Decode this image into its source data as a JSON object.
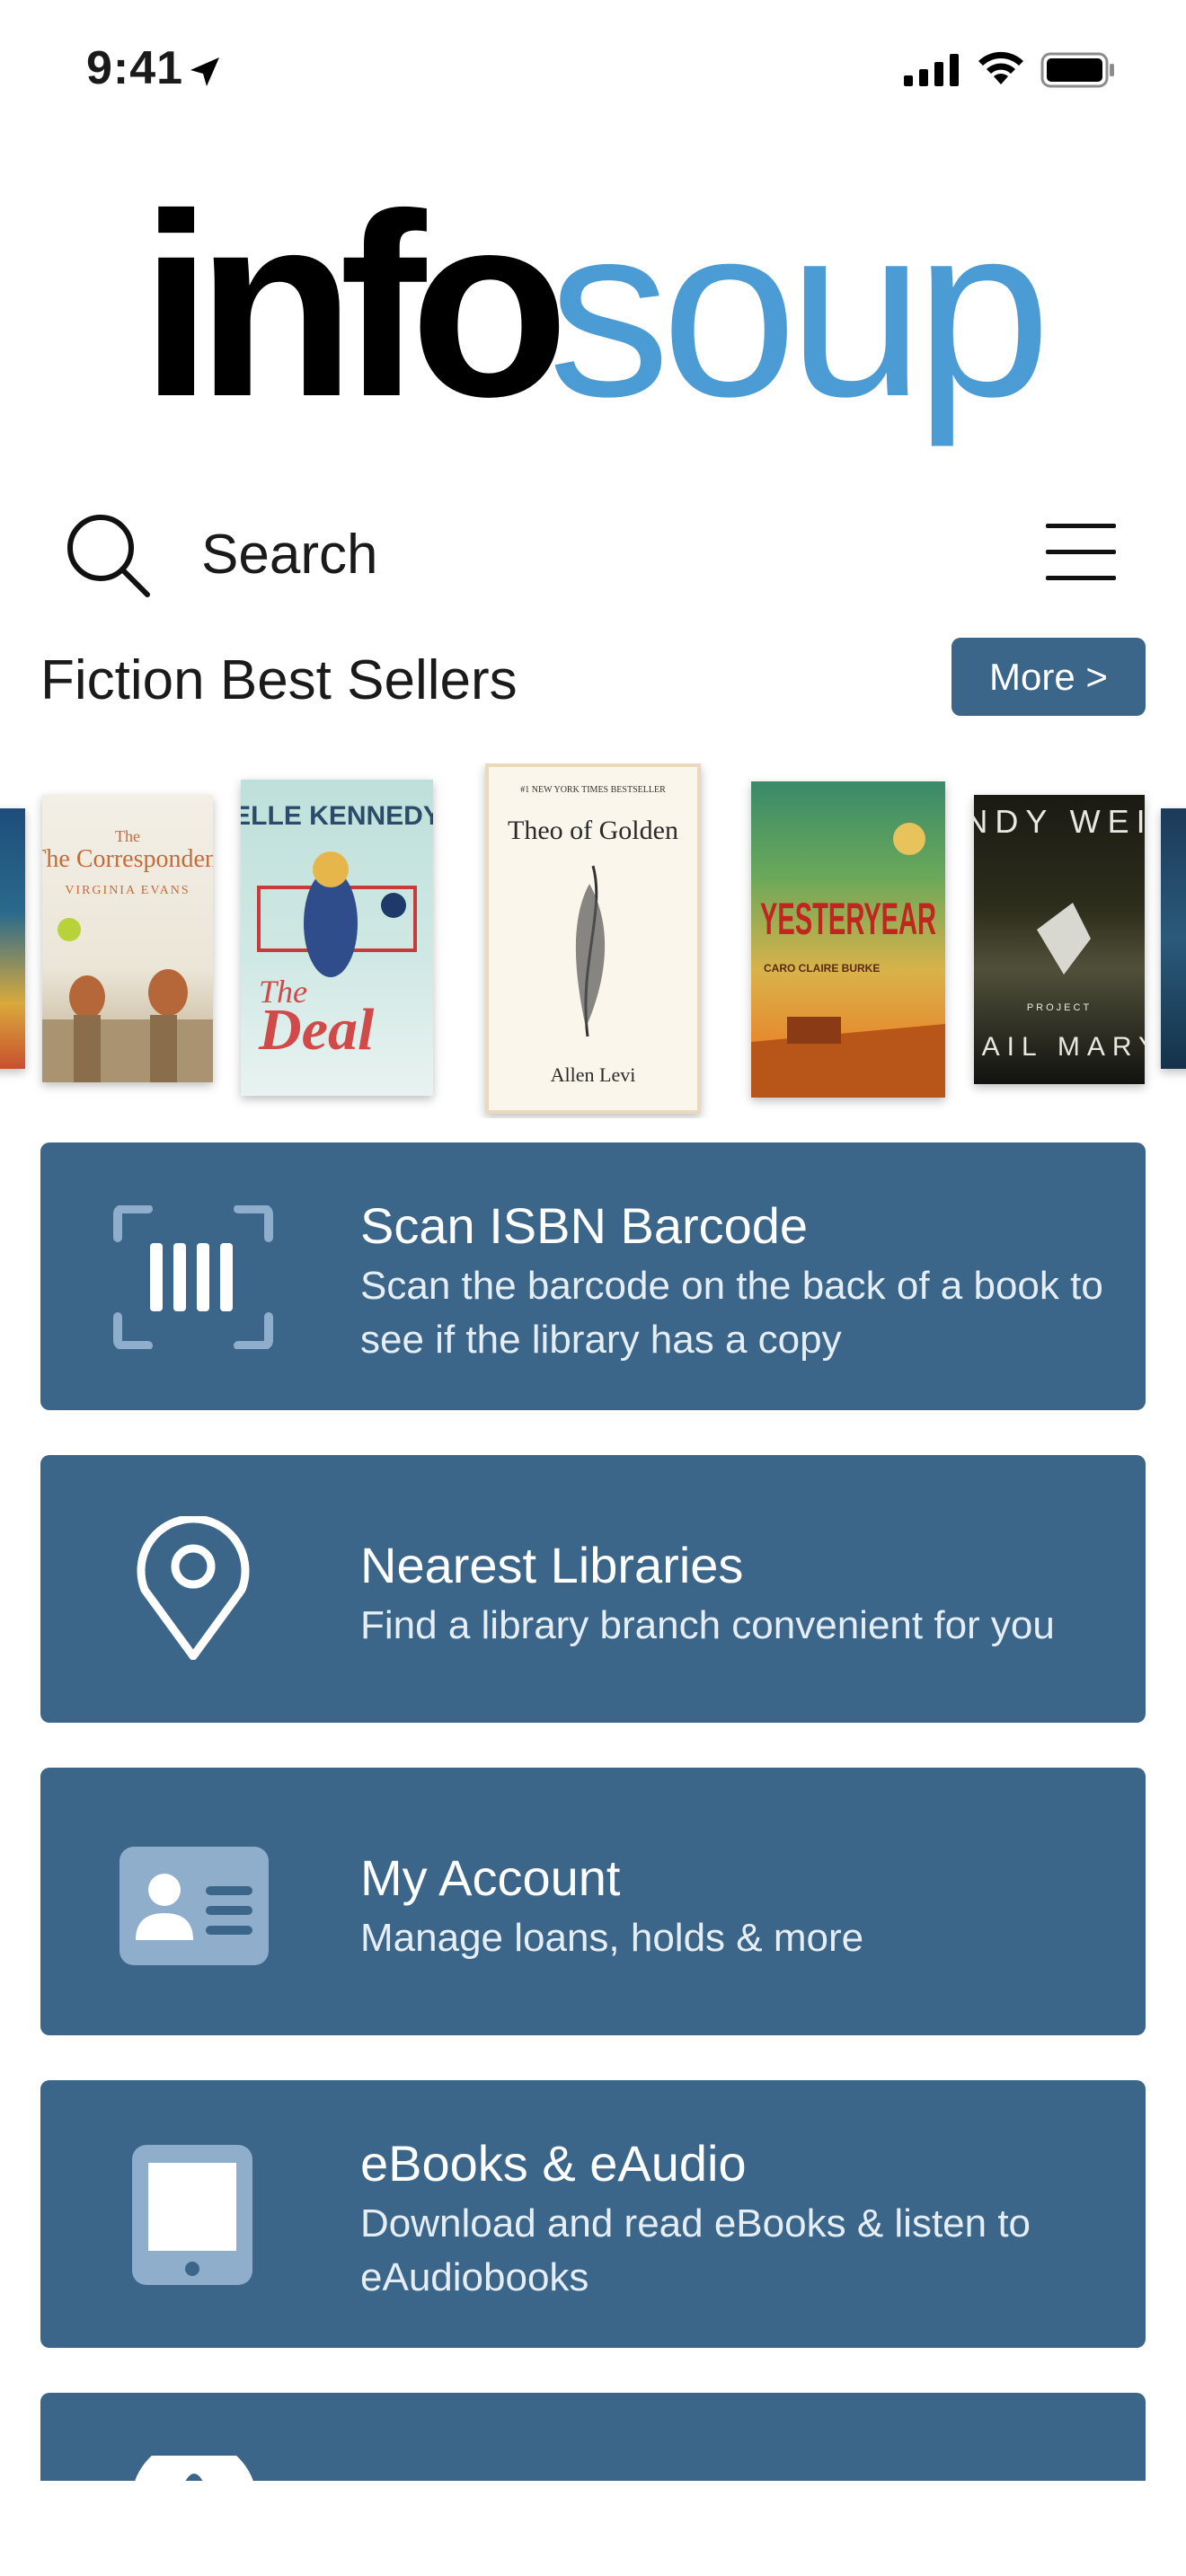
{
  "status_bar": {
    "time": "9:41"
  },
  "logo": {
    "part1": "info",
    "part2": "soup"
  },
  "search": {
    "label": "Search"
  },
  "section": {
    "title": "Fiction Best Sellers",
    "more_label": "More >"
  },
  "books": [
    {
      "title": "The Correspondent",
      "author": "VIRGINIA EVANS"
    },
    {
      "title": "The Deal",
      "author": "ELLE KENNEDY"
    },
    {
      "title": "Theo of Golden",
      "author": "Allen Levi"
    },
    {
      "title": "YESTERYEAR",
      "author": "CARO CLAIRE BURKE"
    },
    {
      "title": "HAIL MARY",
      "author": "ANDY WEIR"
    }
  ],
  "cards": [
    {
      "title": "Scan ISBN Barcode",
      "subtitle": "Scan the barcode on the back of a book to see if the library has a copy",
      "icon": "barcode-scan-icon"
    },
    {
      "title": "Nearest Libraries",
      "subtitle": "Find a library branch convenient for you",
      "icon": "map-pin-icon"
    },
    {
      "title": "My Account",
      "subtitle": "Manage loans, holds & more",
      "icon": "id-card-icon"
    },
    {
      "title": "eBooks & eAudio",
      "subtitle": "Download and read eBooks & listen to eAudiobooks",
      "icon": "tablet-icon"
    }
  ],
  "colors": {
    "accent": "#3b6589",
    "logo_blue": "#4b9bd4",
    "logo_black": "#000000"
  }
}
